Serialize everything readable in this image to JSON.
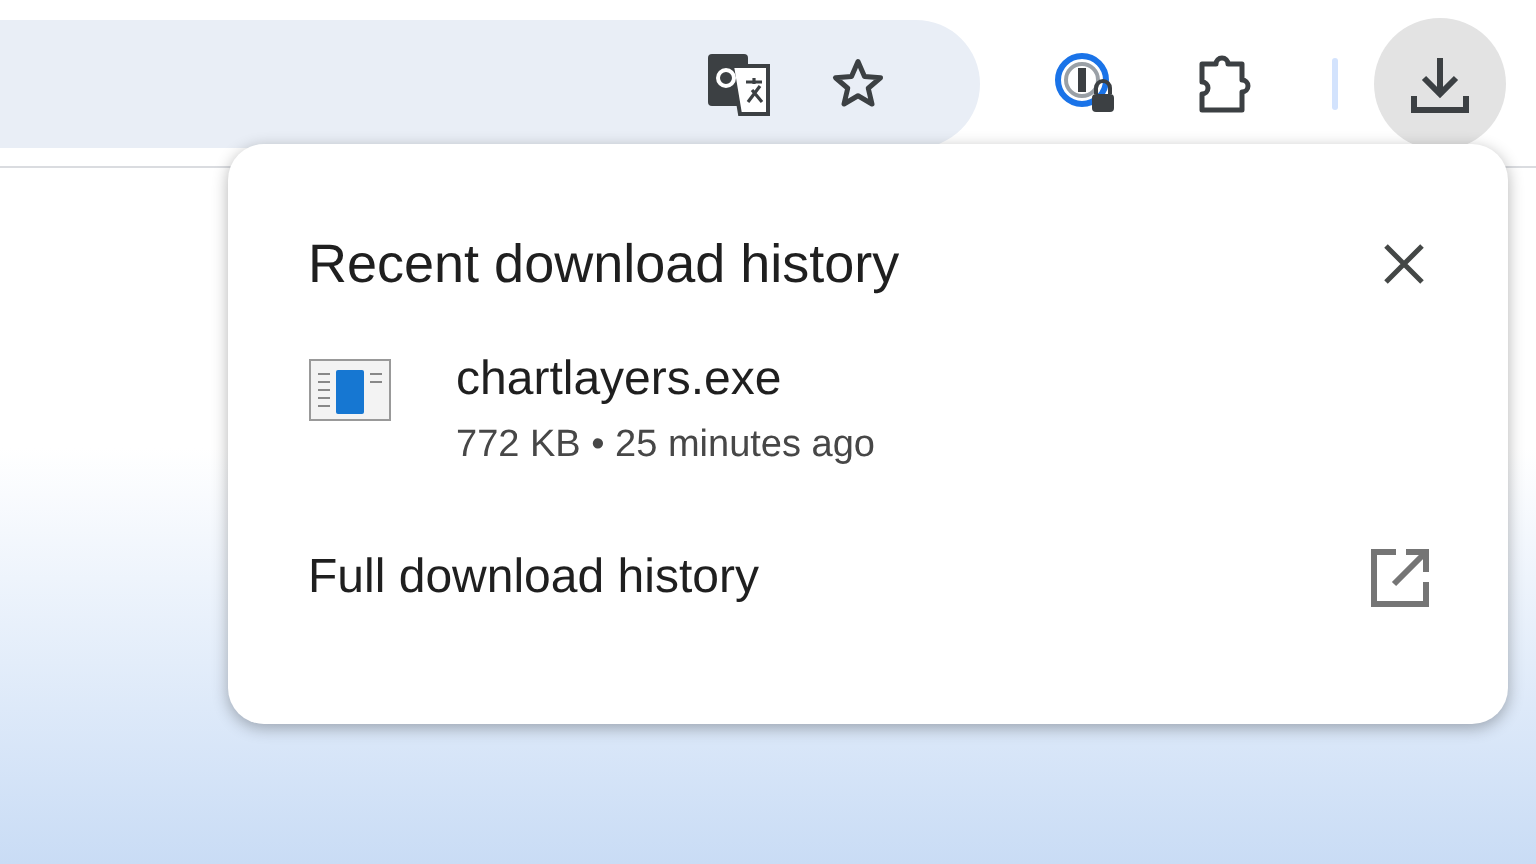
{
  "popup": {
    "title": "Recent download history",
    "downloads": [
      {
        "name": "chartlayers.exe",
        "details": "772 KB • 25 minutes ago"
      }
    ],
    "footer_link": "Full download history"
  }
}
